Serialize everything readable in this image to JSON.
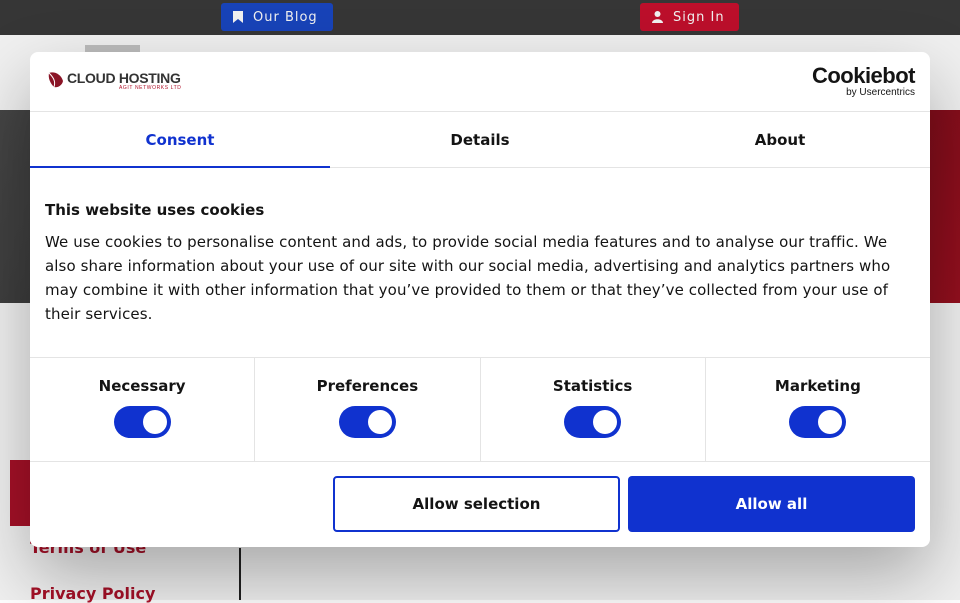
{
  "topbar": {
    "blog_label": "Our Blog",
    "signin_label": "Sign In"
  },
  "footer": {
    "terms_label": "Terms of Use",
    "privacy_label": "Privacy Policy"
  },
  "dialog": {
    "brand": {
      "name": "CLOUD HOSTING",
      "subtitle": "AGIT NETWORKS LTD"
    },
    "provider": {
      "name": "Cookiebot",
      "byline": "by Usercentrics"
    },
    "tabs": [
      {
        "label": "Consent",
        "active": true
      },
      {
        "label": "Details",
        "active": false
      },
      {
        "label": "About",
        "active": false
      }
    ],
    "title": "This website uses cookies",
    "body": "We use cookies to personalise content and ads, to provide social media features and to analyse our traffic. We also share information about your use of our site with our social media, advertising and analytics partners who may combine it with other information that you’ve provided to them or that they’ve collected from your use of their services.",
    "toggles": [
      {
        "label": "Necessary",
        "on": true
      },
      {
        "label": "Preferences",
        "on": true
      },
      {
        "label": "Statistics",
        "on": true
      },
      {
        "label": "Marketing",
        "on": true
      }
    ],
    "allow_selection_label": "Allow selection",
    "allow_all_label": "Allow all"
  },
  "colors": {
    "primary_blue": "#1032cf",
    "brand_red": "#c8102e",
    "topbar_dark": "#3a3a3a"
  },
  "icons": {
    "blog": "bookmark-icon",
    "signin": "user-icon",
    "brand": "leaf-logo-icon"
  }
}
